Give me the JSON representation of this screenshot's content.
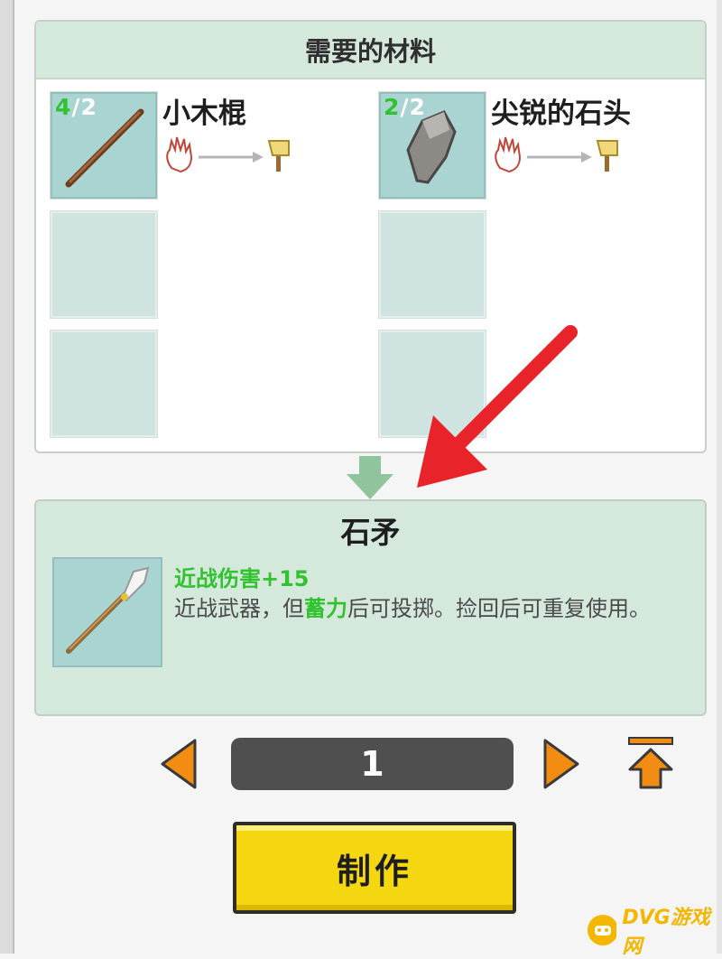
{
  "materials": {
    "header": "需要的材料",
    "items": [
      {
        "name": "小木棍",
        "have": "4",
        "need": "/2",
        "icon": "wooden-stick-icon"
      },
      {
        "name": "尖锐的石头",
        "have": "2",
        "need": "/2",
        "icon": "sharp-stone-icon"
      }
    ]
  },
  "result": {
    "name": "石矛",
    "stat": "近战伤害+15",
    "desc_part1": "近战武器，但",
    "desc_highlight": "蓄力",
    "desc_part2": "后可投掷。捡回后可重复使用。",
    "icon": "stone-spear-icon"
  },
  "controls": {
    "quantity": "1"
  },
  "craft_button": {
    "label": "制作"
  },
  "watermark": {
    "text": "DVG游戏网"
  },
  "colors": {
    "accent_green": "#31c22f",
    "arrow_orange": "#f28c12",
    "button_yellow": "#f4d710",
    "annotation_red": "#e8232a"
  }
}
